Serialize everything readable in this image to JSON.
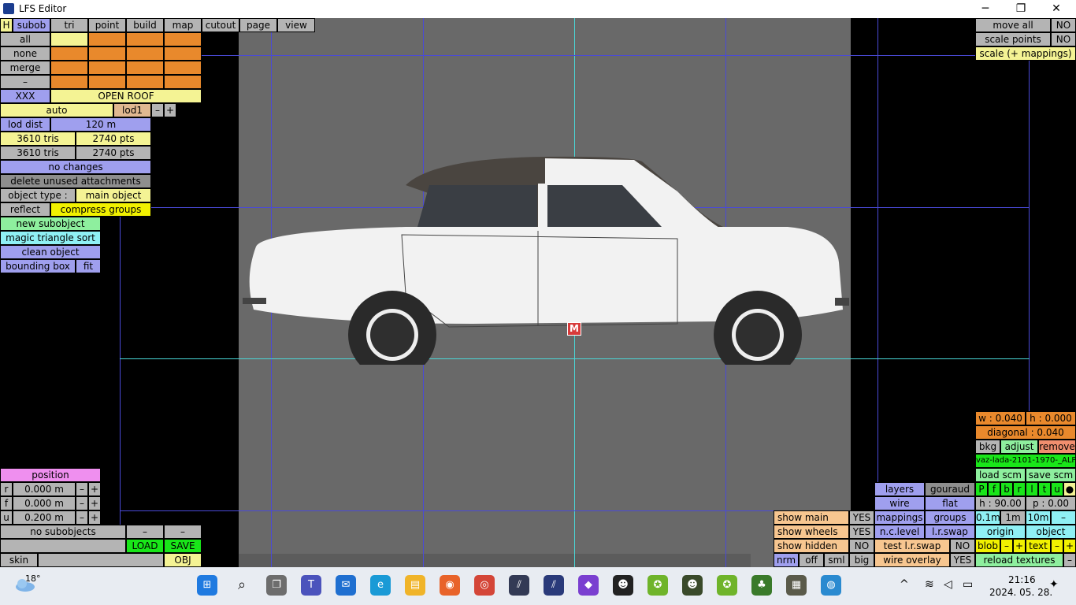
{
  "window": {
    "title": "LFS Editor",
    "minimize": "─",
    "maximize": "❐",
    "close": "✕"
  },
  "menu": [
    "H",
    "subob",
    "tri",
    "point",
    "build",
    "map",
    "cutout",
    "page",
    "view"
  ],
  "left": {
    "all": "all",
    "none": "none",
    "merge": "merge",
    "dash": "–",
    "xxx": "XXX",
    "subobject_name": "OPEN ROOF",
    "auto": "auto",
    "lod": "lod1",
    "minus": "–",
    "plus": "+",
    "lod_dist_label": "lod dist",
    "lod_dist_value": "120 m",
    "tris1": "3610 tris",
    "pts1": "2740 pts",
    "tris2": "3610 tris",
    "pts2": "2740 pts",
    "no_changes": "no changes",
    "delete_unused": "delete unused attachments",
    "object_type_label": "object type :",
    "object_type_value": "main object",
    "reflect": "reflect",
    "compress_groups": "compress groups",
    "new_subobject": "new subobject",
    "magic_sort": "magic triangle sort",
    "clean_object": "clean object",
    "bounding_box": "bounding box",
    "fit": "fit"
  },
  "position": {
    "title": "position",
    "rows": [
      {
        "axis": "r",
        "value": "0.000 m"
      },
      {
        "axis": "f",
        "value": "0.000 m"
      },
      {
        "axis": "u",
        "value": "0.200 m"
      }
    ],
    "minus": "–",
    "plus": "+",
    "no_subobjects": "no subobjects",
    "load": "LOAD",
    "save": "SAVE",
    "skin": "skin",
    "obj": "OBJ"
  },
  "top_right": {
    "move_all": "move all",
    "move_all_val": "NO",
    "scale_points": "scale points",
    "scale_points_val": "NO",
    "scale_mappings": "scale (+ mappings)"
  },
  "marker": "M",
  "bg_panel": {
    "w": "w : 0.040",
    "h": "h : 0.000",
    "diagonal": "diagonal : 0.040",
    "bkg": "bkg",
    "adjust": "adjust",
    "remove": "remove",
    "filename": "vaz-lada-2101-1970-_ALP",
    "load_scm": "load scm",
    "save_scm": "save scm",
    "letters": [
      "P",
      "f",
      "b",
      "r",
      "l",
      "t",
      "u",
      "●"
    ],
    "heading": "h : 90.00",
    "pitch": "p : 0.00",
    "steps": [
      "0.1m",
      "1m",
      "10m",
      "–"
    ],
    "origin": "origin",
    "object": "object",
    "blob": "blob",
    "text": "text",
    "minus": "–",
    "plus": "+",
    "reload_textures": "reload textures",
    "dash": "–"
  },
  "view_panel": {
    "layers": "layers",
    "gouraud": "gouraud",
    "wire": "wire",
    "flat": "flat",
    "mappings": "mappings",
    "groups": "groups",
    "nclevel": "n.c.level",
    "lrswap": "l.r.swap",
    "test_lrswap": "test l.r.swap",
    "test_val": "NO",
    "wire_overlay": "wire overlay",
    "wire_overlay_val": "YES"
  },
  "show_panel": {
    "show_main": "show main",
    "show_main_val": "YES",
    "show_wheels": "show wheels",
    "show_wheels_val": "YES",
    "show_hidden": "show hidden",
    "show_hidden_val": "NO",
    "nrm": "nrm",
    "off": "off",
    "sml": "sml",
    "big": "big"
  },
  "taskbar": {
    "temperature": "18°",
    "time": "21:16",
    "date": "2024. 05. 28."
  },
  "colors": {
    "purple": "#9f9fee",
    "orange": "#e9892c",
    "yellow": "#f0ef84",
    "green": "#19e619",
    "cyan": "#8ff0f4"
  }
}
